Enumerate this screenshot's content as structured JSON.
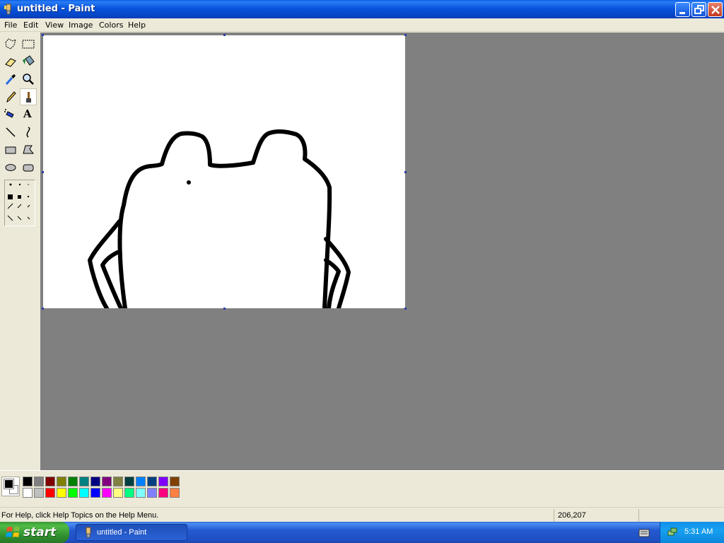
{
  "window": {
    "title": "untitled - Paint",
    "icons": [
      "paint-app-icon",
      "minimize-icon",
      "restore-icon",
      "close-icon"
    ]
  },
  "menu": {
    "items": [
      "File",
      "Edit",
      "View",
      "Image",
      "Colors",
      "Help"
    ]
  },
  "toolbox": {
    "tools": [
      {
        "name": "free-form-select-icon"
      },
      {
        "name": "select-icon"
      },
      {
        "name": "eraser-icon"
      },
      {
        "name": "fill-with-color-icon"
      },
      {
        "name": "pick-color-icon"
      },
      {
        "name": "magnifier-icon"
      },
      {
        "name": "pencil-icon"
      },
      {
        "name": "brush-icon",
        "selected": true
      },
      {
        "name": "airbrush-icon"
      },
      {
        "name": "text-icon"
      },
      {
        "name": "line-icon"
      },
      {
        "name": "curve-icon"
      },
      {
        "name": "rectangle-icon"
      },
      {
        "name": "polygon-icon"
      },
      {
        "name": "ellipse-icon"
      },
      {
        "name": "rounded-rectangle-icon"
      }
    ],
    "text_tool_glyph": "A"
  },
  "palette": {
    "foreground": "#000000",
    "background": "#ffffff",
    "colors_row1": [
      "#000000",
      "#808080",
      "#800000",
      "#808000",
      "#008000",
      "#008080",
      "#000080",
      "#800080",
      "#808040",
      "#004040",
      "#0080ff",
      "#004080",
      "#8000ff",
      "#804000"
    ],
    "colors_row2": [
      "#ffffff",
      "#c0c0c0",
      "#ff0000",
      "#ffff00",
      "#00ff00",
      "#00ffff",
      "#0000ff",
      "#ff00ff",
      "#ffff80",
      "#00ff80",
      "#80ffff",
      "#8080ff",
      "#ff0080",
      "#ff8040"
    ]
  },
  "status": {
    "help_text": "For Help, click Help Topics on the Help Menu.",
    "coordinates": "206,207"
  },
  "taskbar": {
    "start_label": "start",
    "task_label": "untitled - Paint",
    "clock": "5:31 AM"
  }
}
